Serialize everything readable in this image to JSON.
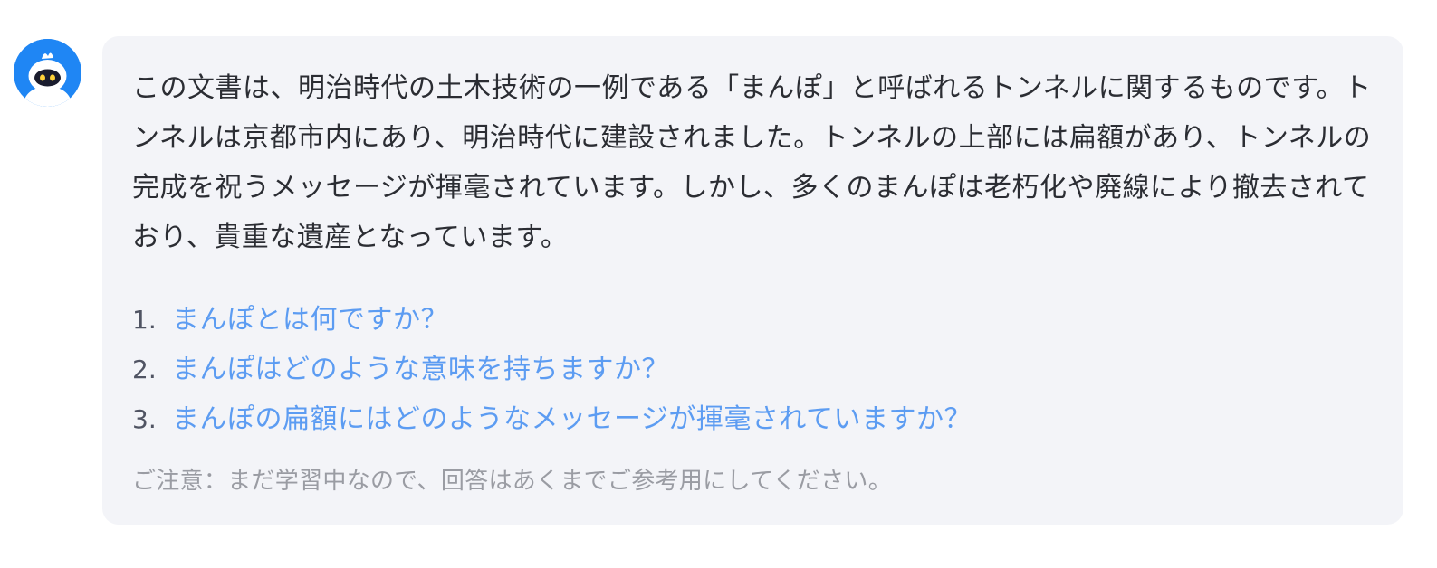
{
  "assistant": {
    "avatar_icon": "robot-icon",
    "avatar_color": "#1f86f4"
  },
  "message": {
    "intro": "この文書は、明治時代の土木技術の一例である「まんぽ」と呼ばれるトンネルに関するものです。トンネルは京都市内にあり、明治時代に建設されました。トンネルの上部には扁額があり、トンネルの完成を祝うメッセージが揮毫されています。しかし、多くのまんぽは老朽化や廃線により撤去されており、貴重な遺産となっています。",
    "questions": [
      {
        "number": "1.",
        "text": "まんぽとは何ですか？"
      },
      {
        "number": "2.",
        "text": "まんぽはどのような意味を持ちますか？"
      },
      {
        "number": "3.",
        "text": "まんぽの扁額にはどのようなメッセージが揮毫されていますか？"
      }
    ],
    "notice": "ご注意：まだ学習中なので、回答はあくまでご参考用にしてください。"
  },
  "colors": {
    "bubble_background": "#f3f4f8",
    "body_text": "#2b2d33",
    "link_text": "#5c9cf2",
    "notice_text": "#9a9ca3"
  }
}
